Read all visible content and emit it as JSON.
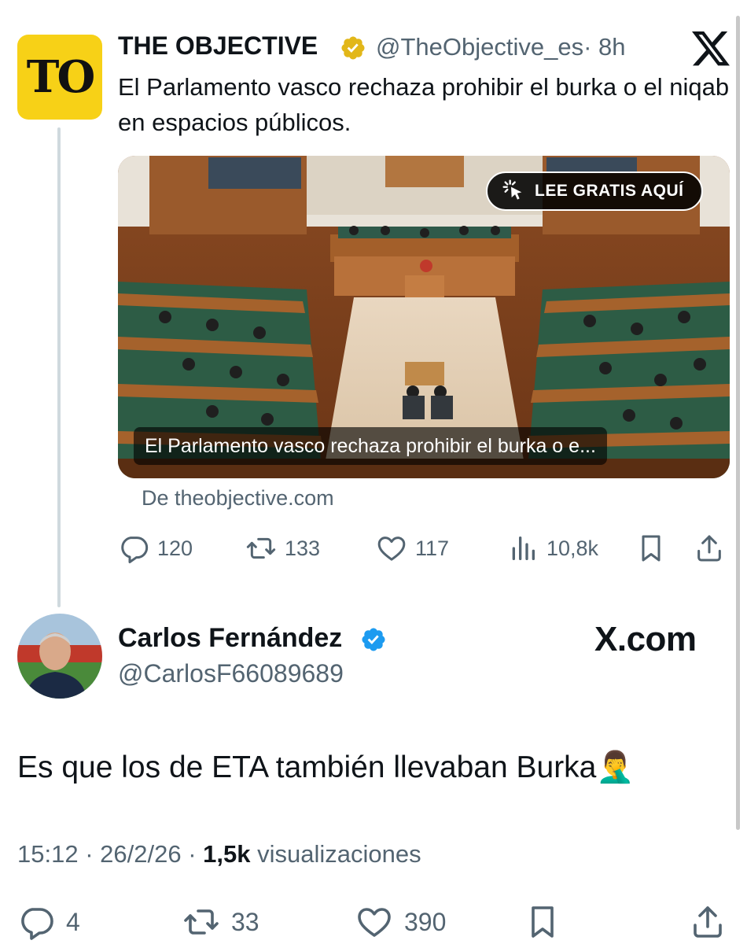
{
  "quoted_tweet": {
    "logo_text": "TO",
    "account_name": "THE OBJECTIVE",
    "handle": "@TheObjective_es",
    "time": "· 8h",
    "text": "El Parlamento vasco rechaza prohibir el burka o el niqab en espacios públicos.",
    "card": {
      "cta_label": "LEE GRATIS AQUÍ",
      "caption": "El Parlamento vasco rechaza prohibir el burka o e...",
      "source": "De theobjective.com"
    },
    "actions": {
      "replies": "120",
      "reposts": "133",
      "likes": "117",
      "views": "10,8k"
    }
  },
  "reply_tweet": {
    "author_name": "Carlos Fernández",
    "handle": "@CarlosF66089689",
    "watermark": "X.com",
    "text": "Es que los de ETA también llevaban Burka",
    "emoji": "🤦‍♂️",
    "time": "15:12",
    "date": "26/2/26",
    "views_count": "1,5k",
    "views_label": "visualizaciones",
    "actions": {
      "replies": "4",
      "reposts": "33",
      "likes": "390"
    }
  },
  "colors": {
    "text_primary": "#0f1419",
    "text_secondary": "#536471",
    "verified_blue": "#1d9bf0",
    "verified_gold": "#e2b719",
    "logo_yellow": "#f7d117"
  },
  "icons": [
    "gold-verified-icon",
    "x-logo-icon",
    "cursor-click-icon",
    "reply-icon",
    "repost-icon",
    "like-icon",
    "views-icon",
    "bookmark-icon",
    "share-icon",
    "blue-verified-icon"
  ]
}
